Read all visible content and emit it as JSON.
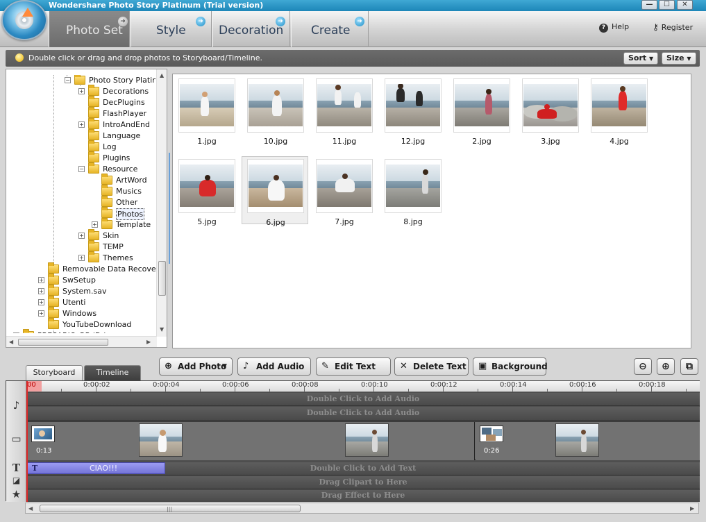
{
  "app": {
    "title": "Wondershare Photo Story Platinum  (Trial version)",
    "window_buttons": [
      "—",
      "☐",
      "✕"
    ]
  },
  "nav": {
    "tabs": [
      {
        "label": "Photo Set",
        "active": true
      },
      {
        "label": "Style",
        "active": false
      },
      {
        "label": "Decoration",
        "active": false
      },
      {
        "label": "Create",
        "active": false
      }
    ],
    "help_label": "Help",
    "register_label": "Register"
  },
  "hint": {
    "text": "Double click or drag and drop photos to Storyboard/Timeline.",
    "sort_label": "Sort",
    "size_label": "Size"
  },
  "tree": {
    "items": [
      {
        "label": "Photo Story Platinum",
        "level": 4,
        "toggle": "minus"
      },
      {
        "label": "Decorations",
        "level": 5,
        "toggle": "plus"
      },
      {
        "label": "DecPlugins",
        "level": 5,
        "toggle": ""
      },
      {
        "label": "FlashPlayer",
        "level": 5,
        "toggle": ""
      },
      {
        "label": "IntroAndEnd",
        "level": 5,
        "toggle": "plus"
      },
      {
        "label": "Language",
        "level": 5,
        "toggle": ""
      },
      {
        "label": "Log",
        "level": 5,
        "toggle": ""
      },
      {
        "label": "Plugins",
        "level": 5,
        "toggle": ""
      },
      {
        "label": "Resource",
        "level": 5,
        "toggle": "minus"
      },
      {
        "label": "ArtWord",
        "level": 6,
        "toggle": ""
      },
      {
        "label": "Musics",
        "level": 6,
        "toggle": ""
      },
      {
        "label": "Other",
        "level": 6,
        "toggle": ""
      },
      {
        "label": "Photos",
        "level": 6,
        "toggle": "",
        "selected": true
      },
      {
        "label": "Template",
        "level": 6,
        "toggle": "plus"
      },
      {
        "label": "Skin",
        "level": 5,
        "toggle": "plus"
      },
      {
        "label": "TEMP",
        "level": 5,
        "toggle": ""
      },
      {
        "label": "Themes",
        "level": 5,
        "toggle": "plus"
      },
      {
        "label": "Removable Data Recovery",
        "level": 2,
        "toggle": ""
      },
      {
        "label": "SwSetup",
        "level": 2,
        "toggle": "plus"
      },
      {
        "label": "System.sav",
        "level": 2,
        "toggle": "plus"
      },
      {
        "label": "Utenti",
        "level": 2,
        "toggle": "plus"
      },
      {
        "label": "Windows",
        "level": 2,
        "toggle": "plus"
      },
      {
        "label": "YouTubeDownload",
        "level": 2,
        "toggle": ""
      },
      {
        "label": "PRESARIO_RP (D:)",
        "level": 1,
        "toggle": "plus"
      }
    ]
  },
  "photos": [
    {
      "name": "1.jpg"
    },
    {
      "name": "10.jpg"
    },
    {
      "name": "11.jpg"
    },
    {
      "name": "12.jpg"
    },
    {
      "name": "2.jpg"
    },
    {
      "name": "3.jpg"
    },
    {
      "name": "4.jpg"
    },
    {
      "name": "5.jpg"
    },
    {
      "name": "6.jpg",
      "selected": true
    },
    {
      "name": "7.jpg"
    },
    {
      "name": "8.jpg"
    }
  ],
  "timeline": {
    "tabs": [
      {
        "label": "Storyboard"
      },
      {
        "label": "Timeline"
      }
    ],
    "tools": [
      {
        "label": "Add Photo",
        "icon": "add-circle-icon",
        "glyph": "⊕",
        "dropdown": true
      },
      {
        "label": "Add Audio",
        "icon": "add-audio-icon",
        "glyph": "♪",
        "dropdown": false
      },
      {
        "label": "Edit Text",
        "icon": "edit-text-icon",
        "glyph": "✎",
        "dropdown": false
      },
      {
        "label": "Delete Text",
        "icon": "delete-icon",
        "glyph": "✕",
        "dropdown": false
      },
      {
        "label": "Background",
        "icon": "background-icon",
        "glyph": "▣",
        "dropdown": false
      }
    ],
    "ruler": {
      "start": "00",
      "labels": [
        "0:00:02",
        "0:00:04",
        "0:00:06",
        "0:00:08",
        "0:00:10",
        "0:00:12",
        "0:00:14",
        "0:00:16",
        "0:00:18"
      ]
    },
    "audio_hint_1": "Double Click to Add Audio",
    "audio_hint_2": "Double Click to Add Audio",
    "clip_times": [
      "0:13",
      "0:26"
    ],
    "text_clip": "CIAO!!!",
    "text_hint": "Double Click to Add Text",
    "clipart_hint": "Drag Clipart to Here",
    "effect_hint": "Drag Effect to Here"
  }
}
